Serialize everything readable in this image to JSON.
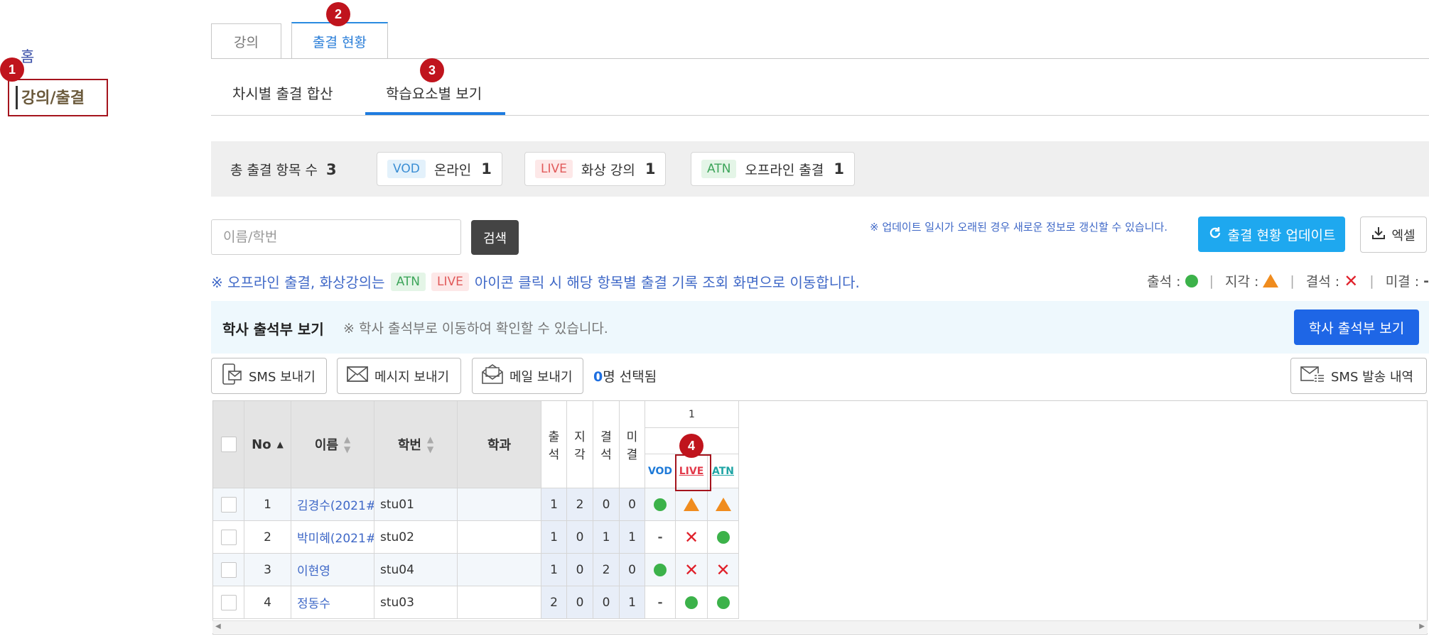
{
  "sidebar": {
    "home_label": "홈",
    "active_label": "강의/출결"
  },
  "markers": [
    "1",
    "2",
    "3",
    "4"
  ],
  "tabs": [
    "강의",
    "출결 현황"
  ],
  "subtabs": [
    "차시별 출결 합산",
    "학습요소별 보기"
  ],
  "summary": {
    "total_label": "총 출결 항목 수",
    "total_value": "3",
    "items": [
      {
        "tag": "VOD",
        "label": "온라인",
        "count": "1"
      },
      {
        "tag": "LIVE",
        "label": "화상 강의",
        "count": "1"
      },
      {
        "tag": "ATN",
        "label": "오프라인 출결",
        "count": "1"
      }
    ]
  },
  "search": {
    "placeholder": "이름/학번",
    "button": "검색"
  },
  "update_notice": "※ 업데이트 일시가 오래된 경우 새로운 정보로 갱신할 수 있습니다.",
  "update_button": "출결 현황 업데이트",
  "excel_button": "엑셀",
  "guide": {
    "prefix": "※ 오프라인 출결, 화상강의는",
    "tag_atn": "ATN",
    "tag_live": "LIVE",
    "suffix": "아이콘 클릭 시 해당 항목별 출결 기록 조회 화면으로 이동합니다."
  },
  "legend": {
    "present": "출석 :",
    "late": "지각 :",
    "absent": "결석 :",
    "undecided": "미결 :",
    "sep": "|",
    "dash": "-"
  },
  "bookbar": {
    "title": "학사 출석부 보기",
    "desc": "※ 학사 출석부로 이동하여 확인할 수 있습니다.",
    "button": "학사 출석부 보기"
  },
  "actions": {
    "sms": "SMS 보내기",
    "message": "메시지 보내기",
    "mail": "메일 보내기",
    "selected_count": "0",
    "selected_suffix": "명 선택됨",
    "sms_history": "SMS 발송 내역"
  },
  "table": {
    "headers": {
      "no": "No",
      "name": "이름",
      "student_id": "학번",
      "dept": "학과",
      "present": "출\n석",
      "late": "지\n각",
      "absent": "결\n석",
      "undecided": "미\n결",
      "session": "1",
      "vod": "VOD",
      "live": "LIVE",
      "atn": "ATN"
    },
    "rows": [
      {
        "no": "1",
        "name": "김경수(2021#",
        "id": "stu01",
        "dept": "",
        "present": "1",
        "late": "2",
        "absent": "0",
        "undecided": "0",
        "vod": "present",
        "live": "late",
        "atn": "late"
      },
      {
        "no": "2",
        "name": "박미혜(2021#",
        "id": "stu02",
        "dept": "",
        "present": "1",
        "late": "0",
        "absent": "1",
        "undecided": "1",
        "vod": "undecided",
        "live": "absent",
        "atn": "present"
      },
      {
        "no": "3",
        "name": "이현영",
        "id": "stu04",
        "dept": "",
        "present": "1",
        "late": "0",
        "absent": "2",
        "undecided": "0",
        "vod": "present",
        "live": "absent",
        "atn": "absent"
      },
      {
        "no": "4",
        "name": "정동수",
        "id": "stu03",
        "dept": "",
        "present": "2",
        "late": "0",
        "absent": "0",
        "undecided": "1",
        "vod": "undecided",
        "live": "present",
        "atn": "present"
      }
    ]
  },
  "colors": {
    "accent_blue": "#1e66e6",
    "update_blue": "#1ea8ef",
    "marker_red": "#c0141d",
    "present_green": "#3cb24a",
    "late_orange": "#f08c1e",
    "absent_red": "#e0202a"
  }
}
